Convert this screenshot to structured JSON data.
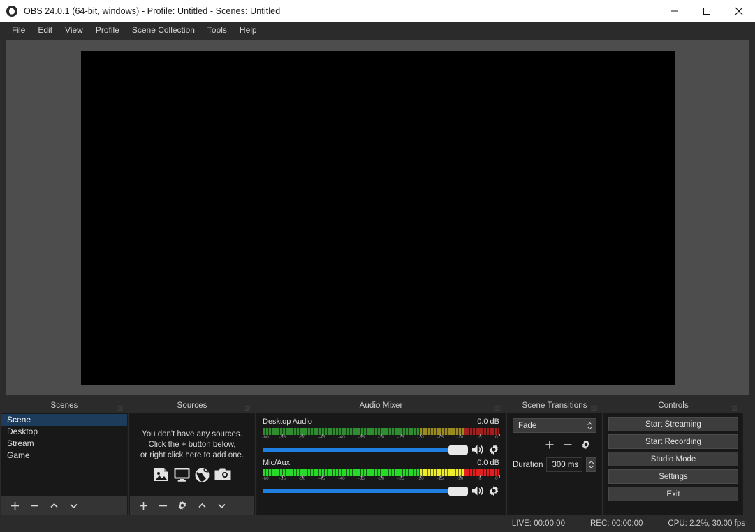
{
  "window": {
    "title": "OBS 24.0.1 (64-bit, windows) - Profile: Untitled - Scenes: Untitled",
    "logo_icon": "obs-logo-icon",
    "minimize_icon": "minimize-icon",
    "maximize_icon": "maximize-icon",
    "close_icon": "close-icon"
  },
  "menubar": {
    "items": [
      {
        "label": "File"
      },
      {
        "label": "Edit"
      },
      {
        "label": "View"
      },
      {
        "label": "Profile"
      },
      {
        "label": "Scene Collection"
      },
      {
        "label": "Tools"
      },
      {
        "label": "Help"
      }
    ]
  },
  "preview": {
    "canvas_color": "#000000",
    "background_color": "#4d4d4d"
  },
  "scenes": {
    "title": "Scenes",
    "float_icon": "dock-float-icon",
    "items": [
      {
        "label": "Scene",
        "selected": true
      },
      {
        "label": "Desktop",
        "selected": false
      },
      {
        "label": "Stream",
        "selected": false
      },
      {
        "label": "Game",
        "selected": false
      }
    ],
    "toolbar": [
      {
        "icon": "add-scene-icon"
      },
      {
        "icon": "remove-scene-icon"
      },
      {
        "icon": "move-scene-up-icon"
      },
      {
        "icon": "move-scene-down-icon"
      }
    ]
  },
  "sources": {
    "title": "Sources",
    "float_icon": "dock-float-icon",
    "empty_lines": [
      "You don't have any sources.",
      "Click the + button below,",
      "or right click here to add one."
    ],
    "empty_icons": [
      {
        "icon": "image-source-icon"
      },
      {
        "icon": "display-capture-icon"
      },
      {
        "icon": "browser-source-icon"
      },
      {
        "icon": "camera-source-icon"
      }
    ],
    "toolbar": [
      {
        "icon": "add-source-icon"
      },
      {
        "icon": "remove-source-icon"
      },
      {
        "icon": "source-properties-gear-icon"
      },
      {
        "icon": "move-source-up-icon"
      },
      {
        "icon": "move-source-down-icon"
      }
    ]
  },
  "mixer": {
    "title": "Audio Mixer",
    "float_icon": "dock-float-icon",
    "scale_ticks": [
      "-60",
      "-55",
      "-50",
      "-45",
      "-40",
      "-35",
      "-30",
      "-25",
      "-20",
      "-15",
      "-10",
      "-5",
      "0"
    ],
    "channels": [
      {
        "name": "Desktop Audio",
        "db": "0.0 dB",
        "volume_percent": 100,
        "meter": {
          "green_percent": 66.7,
          "yellow_percent": 18.3,
          "red_percent": 15.0
        },
        "green_color": "#2f8d2f",
        "yellow_color": "#9a8a22",
        "red_color": "#a02020",
        "mute_icon": "speaker-on-icon",
        "gear_icon": "audio-settings-gear-icon"
      },
      {
        "name": "Mic/Aux",
        "db": "0.0 dB",
        "volume_percent": 100,
        "meter": {
          "green_percent": 66.7,
          "yellow_percent": 18.3,
          "red_percent": 15.0
        },
        "green_color": "#29d929",
        "yellow_color": "#eded2b",
        "red_color": "#e02020",
        "mute_icon": "speaker-on-icon",
        "gear_icon": "audio-settings-gear-icon"
      }
    ]
  },
  "transitions": {
    "title": "Scene Transitions",
    "float_icon": "dock-float-icon",
    "selected_transition": "Fade",
    "dropdown_icon": "chevron-updown-icon",
    "buttons": [
      {
        "icon": "add-transition-icon"
      },
      {
        "icon": "remove-transition-icon"
      },
      {
        "icon": "transition-properties-gear-icon"
      }
    ],
    "duration_label": "Duration",
    "duration_value": "300 ms",
    "spinner_icon": "spinner-updown-icon"
  },
  "controls": {
    "title": "Controls",
    "float_icon": "dock-float-icon",
    "buttons": [
      {
        "label": "Start Streaming"
      },
      {
        "label": "Start Recording"
      },
      {
        "label": "Studio Mode"
      },
      {
        "label": "Settings"
      },
      {
        "label": "Exit"
      }
    ]
  },
  "statusbar": {
    "live": "LIVE: 00:00:00",
    "rec": "REC: 00:00:00",
    "cpu": "CPU: 2.2%, 30.00 fps"
  }
}
